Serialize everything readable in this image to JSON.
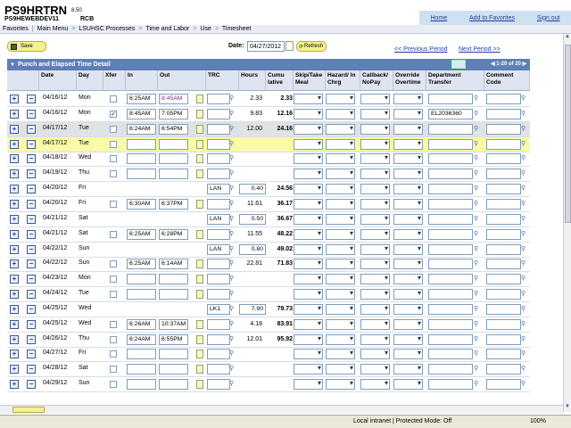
{
  "app": {
    "title": "PS9HRTRN",
    "version": "8.50",
    "db": "PS9HEWEBDEV11",
    "user": "RCB"
  },
  "header_links": [
    "Home",
    "Add to Favorites",
    "Sign out"
  ],
  "breadcrumbs": [
    "Favorites",
    "Main Menu",
    "LSUHSC Processes",
    "Time and Labor",
    "Use",
    "Timesheet"
  ],
  "toolbar": {
    "save_label": "Save",
    "date_label": "Date:",
    "date_value": "04/27/2012",
    "refresh_label": "Refresh",
    "prev_label": "<< Previous Period",
    "next_label": "Next Period >>"
  },
  "grid": {
    "title": "Punch and Elapsed Time Detail",
    "pager": "1-20 of 20",
    "columns": [
      "Date",
      "Day",
      "Xfer",
      "In",
      "Out",
      "TRC",
      "Hours",
      "Cumu lative",
      "Skip/Take Meal",
      "Hazard/ In Chrg",
      "Callback/ NoPay",
      "Override Overtime",
      "Department Transfer",
      "Comment Code"
    ]
  },
  "rows": [
    {
      "date": "04/16/12",
      "day": "Mon",
      "xfer": false,
      "in": "6:25AM",
      "out": "8:45AM",
      "trc": "",
      "hours": "2.33",
      "cum": "2.33",
      "dept": "",
      "type": "punch",
      "out_violet": true
    },
    {
      "date": "04/16/12",
      "day": "Mon",
      "xfer": true,
      "in": "8:45AM",
      "out": "7:05PM",
      "trc": "",
      "hours": "9.83",
      "cum": "12.16",
      "dept": "EL2036360",
      "type": "punch"
    },
    {
      "date": "04/17/12",
      "day": "Tue",
      "xfer": false,
      "in": "6:24AM",
      "out": "6:54PM",
      "trc": "",
      "hours": "12.00",
      "cum": "24.16",
      "dept": "",
      "type": "gray"
    },
    {
      "date": "04/17/12",
      "day": "Tue",
      "xfer": false,
      "in": "",
      "out": "",
      "trc": "",
      "hours": "",
      "cum": "",
      "dept": "",
      "type": "highlight"
    },
    {
      "date": "04/18/12",
      "day": "Wed",
      "xfer": false,
      "in": "",
      "out": "",
      "trc": "",
      "hours": "",
      "cum": "",
      "dept": "",
      "type": "punch"
    },
    {
      "date": "04/19/12",
      "day": "Thu",
      "xfer": false,
      "in": "",
      "out": "",
      "trc": "",
      "hours": "",
      "cum": "",
      "dept": "",
      "type": "punch"
    },
    {
      "date": "04/20/12",
      "day": "Fri",
      "xfer": null,
      "in": null,
      "out": null,
      "trc": "LAN",
      "hours": "0.40",
      "cum": "24.56",
      "dept": "",
      "type": "elapsed"
    },
    {
      "date": "04/20/12",
      "day": "Fri",
      "xfer": false,
      "in": "6:30AM",
      "out": "6:37PM",
      "trc": "",
      "hours": "11.61",
      "cum": "36.17",
      "dept": "",
      "type": "punch"
    },
    {
      "date": "04/21/12",
      "day": "Sat",
      "xfer": null,
      "in": null,
      "out": null,
      "trc": "LAN",
      "hours": "0.50",
      "cum": "36.67",
      "dept": "",
      "type": "elapsed"
    },
    {
      "date": "04/21/12",
      "day": "Sat",
      "xfer": false,
      "in": "6:25AM",
      "out": "6:28PM",
      "trc": "",
      "hours": "11.55",
      "cum": "48.22",
      "dept": "",
      "type": "punch"
    },
    {
      "date": "04/22/12",
      "day": "Sun",
      "xfer": null,
      "in": null,
      "out": null,
      "trc": "LAN",
      "hours": "0.80",
      "cum": "49.02",
      "dept": "",
      "type": "elapsed"
    },
    {
      "date": "04/22/12",
      "day": "Sun",
      "xfer": false,
      "in": "6:25AM",
      "out": "6:14AM",
      "trc": "",
      "hours": "22.81",
      "cum": "71.83",
      "dept": "",
      "type": "punch"
    },
    {
      "date": "04/23/12",
      "day": "Mon",
      "xfer": false,
      "in": "",
      "out": "",
      "trc": "",
      "hours": "",
      "cum": "",
      "dept": "",
      "type": "punch"
    },
    {
      "date": "04/24/12",
      "day": "Tue",
      "xfer": false,
      "in": "",
      "out": "",
      "trc": "",
      "hours": "",
      "cum": "",
      "dept": "",
      "type": "punch"
    },
    {
      "date": "04/25/12",
      "day": "Wed",
      "xfer": null,
      "in": null,
      "out": null,
      "trc": "LK1",
      "hours": "7.90",
      "cum": "79.73",
      "dept": "",
      "type": "elapsed"
    },
    {
      "date": "04/25/12",
      "day": "Wed",
      "xfer": false,
      "in": "6:26AM",
      "out": "10:37AM",
      "trc": "",
      "hours": "4.18",
      "cum": "83.91",
      "dept": "",
      "type": "punch"
    },
    {
      "date": "04/26/12",
      "day": "Thu",
      "xfer": false,
      "in": "6:24AM",
      "out": "6:55PM",
      "trc": "",
      "hours": "12.01",
      "cum": "95.92",
      "dept": "",
      "type": "punch"
    },
    {
      "date": "04/27/12",
      "day": "Fri",
      "xfer": false,
      "in": "",
      "out": "",
      "trc": "",
      "hours": "",
      "cum": "",
      "dept": "",
      "type": "punch"
    },
    {
      "date": "04/28/12",
      "day": "Sat",
      "xfer": false,
      "in": "",
      "out": "",
      "trc": "",
      "hours": "",
      "cum": "",
      "dept": "",
      "type": "punch"
    },
    {
      "date": "04/29/12",
      "day": "Sun",
      "xfer": false,
      "in": "",
      "out": "",
      "trc": "",
      "hours": "",
      "cum": "",
      "dept": "",
      "type": "punch"
    }
  ],
  "statusbar": {
    "zone": "Local intranet | Protected Mode: Off",
    "zoom": "100%"
  },
  "colors": {
    "grid_header": "#5f7fb7",
    "highlight_row": "#fafaa8",
    "button_yellow": "#f5f090",
    "link": "#1f3f9f"
  }
}
